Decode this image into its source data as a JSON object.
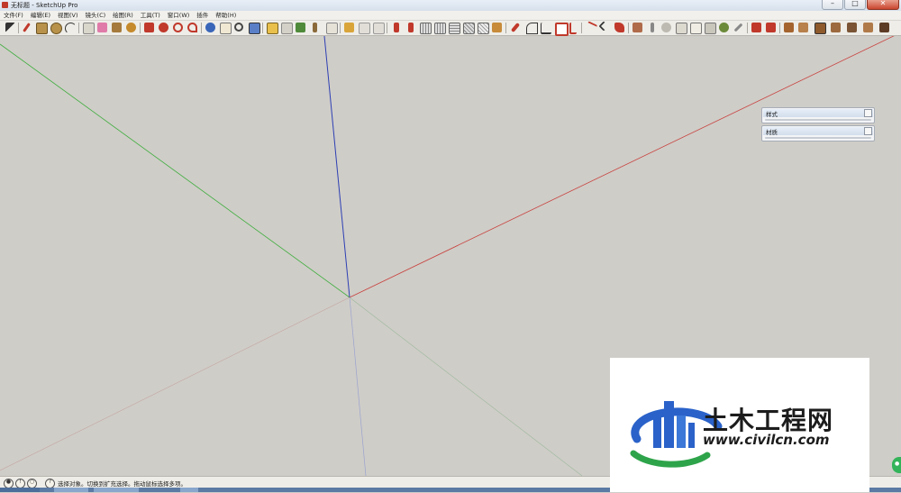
{
  "window": {
    "title": "无标题 - SketchUp Pro",
    "minimize": "–",
    "maximize": "□",
    "close": "✕"
  },
  "menubar": {
    "items": [
      {
        "label": "文件(F)"
      },
      {
        "label": "编辑(E)"
      },
      {
        "label": "视图(V)"
      },
      {
        "label": "镜头(C)"
      },
      {
        "label": "绘图(R)"
      },
      {
        "label": "工具(T)"
      },
      {
        "label": "窗口(W)"
      },
      {
        "label": "插件"
      },
      {
        "label": "帮助(H)"
      }
    ]
  },
  "trays": [
    {
      "label": "样式"
    },
    {
      "label": "材质"
    }
  ],
  "statusbar": {
    "text": "选择对象。切换到扩充选择。拖动鼠标选择多项。",
    "help_glyph": "?"
  },
  "watermark": {
    "title": "土木工程网",
    "url": "www.civilcn.com"
  },
  "colors": {
    "background": "#cfcdc8",
    "axis_red": "#c8433f",
    "axis_green": "#3fae3f",
    "axis_blue": "#2d3fb3",
    "logo_blue": "#2a62c9",
    "logo_green": "#2ea44a"
  }
}
